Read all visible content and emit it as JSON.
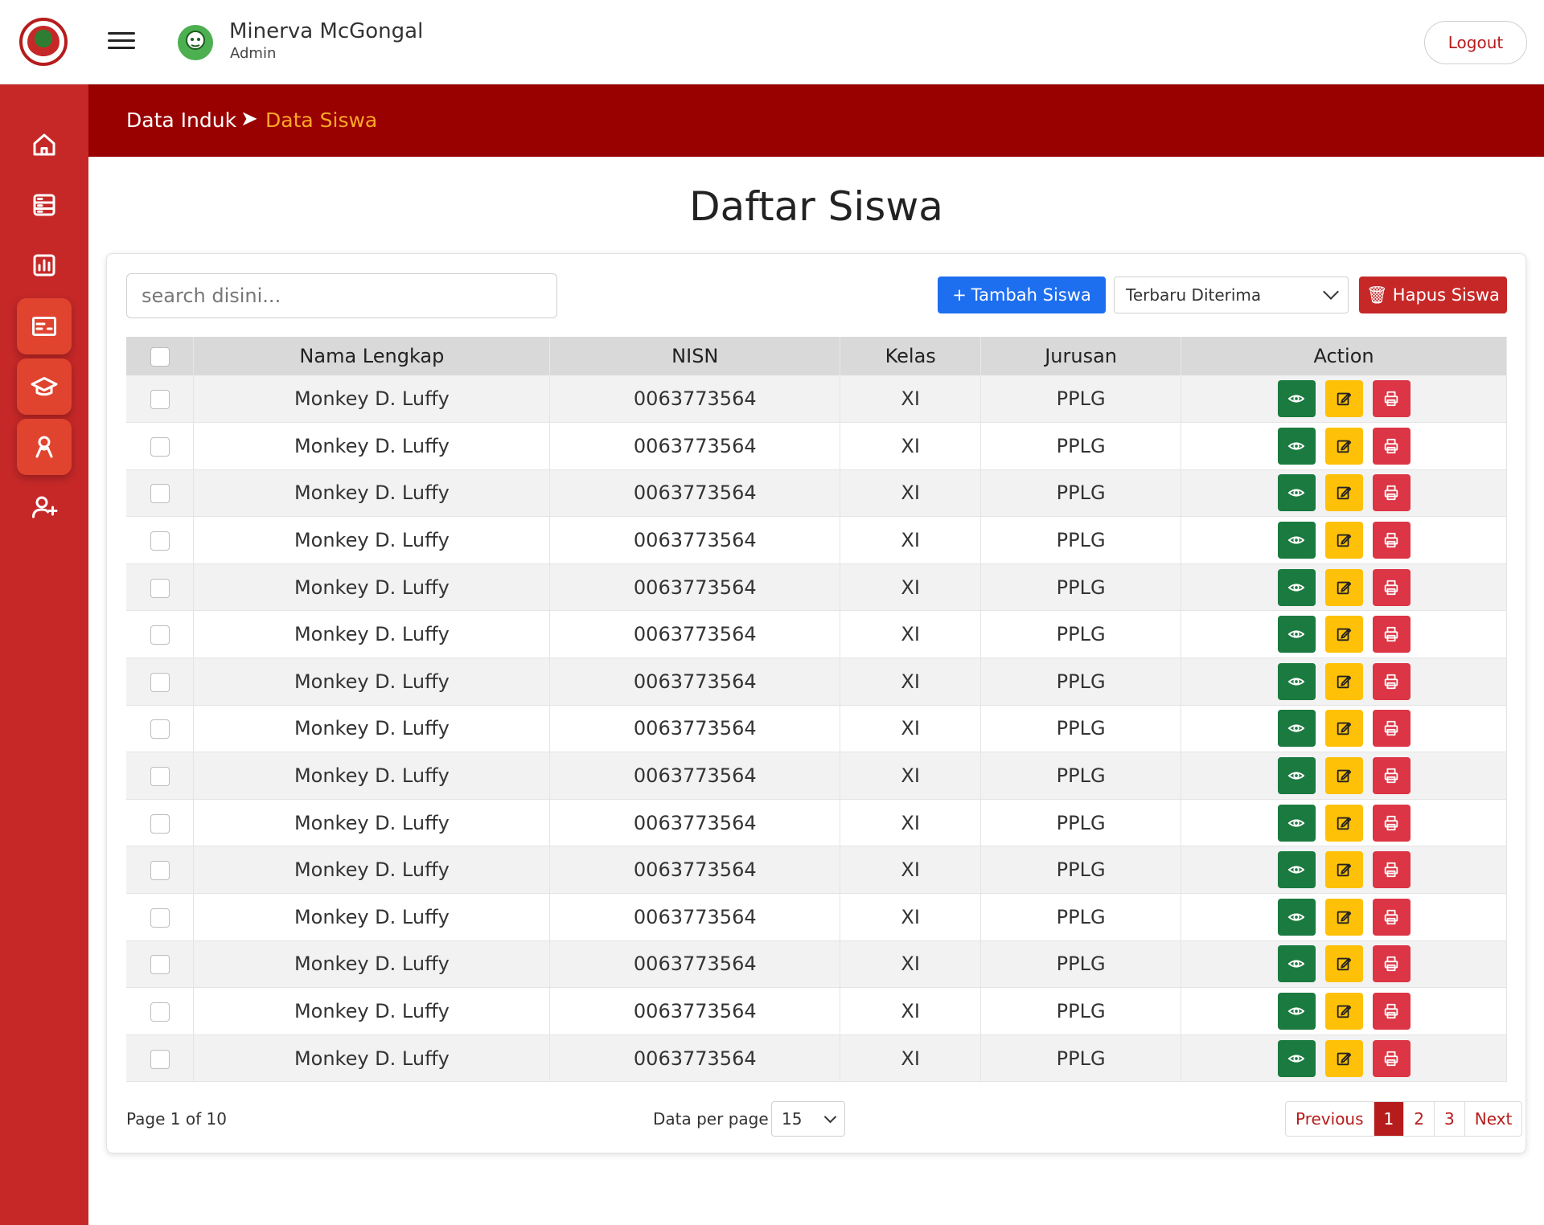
{
  "header": {
    "user_name": "Minerva McGongal",
    "user_role": "Admin",
    "logout_label": "Logout"
  },
  "sidebar": {
    "items": [
      {
        "icon": "home-icon",
        "active": false
      },
      {
        "icon": "server-icon",
        "active": false
      },
      {
        "icon": "chart-icon",
        "active": false
      },
      {
        "icon": "id-card-icon",
        "active": true
      },
      {
        "icon": "graduation-cap-icon",
        "active": true
      },
      {
        "icon": "award-person-icon",
        "active": true
      },
      {
        "icon": "user-plus-icon",
        "active": false
      }
    ]
  },
  "breadcrumb": {
    "parent": "Data Induk",
    "separator": "➤",
    "current": "Data Siswa"
  },
  "page": {
    "title": "Daftar Siswa"
  },
  "toolbar": {
    "search_placeholder": "search disini...",
    "add_label": "Tambah Siswa",
    "add_icon": "+",
    "sort_value": "Terbaru Diterima",
    "delete_label": "Hapus Siswa",
    "delete_icon": "🗑"
  },
  "table": {
    "headers": [
      "Nama Lengkap",
      "NISN",
      "Kelas",
      "Jurusan",
      "Action"
    ],
    "rows": [
      {
        "nama": "Monkey D. Luffy",
        "nisn": "0063773564",
        "kelas": "XI",
        "jurusan": "PPLG"
      },
      {
        "nama": "Monkey D. Luffy",
        "nisn": "0063773564",
        "kelas": "XI",
        "jurusan": "PPLG"
      },
      {
        "nama": "Monkey D. Luffy",
        "nisn": "0063773564",
        "kelas": "XI",
        "jurusan": "PPLG"
      },
      {
        "nama": "Monkey D. Luffy",
        "nisn": "0063773564",
        "kelas": "XI",
        "jurusan": "PPLG"
      },
      {
        "nama": "Monkey D. Luffy",
        "nisn": "0063773564",
        "kelas": "XI",
        "jurusan": "PPLG"
      },
      {
        "nama": "Monkey D. Luffy",
        "nisn": "0063773564",
        "kelas": "XI",
        "jurusan": "PPLG"
      },
      {
        "nama": "Monkey D. Luffy",
        "nisn": "0063773564",
        "kelas": "XI",
        "jurusan": "PPLG"
      },
      {
        "nama": "Monkey D. Luffy",
        "nisn": "0063773564",
        "kelas": "XI",
        "jurusan": "PPLG"
      },
      {
        "nama": "Monkey D. Luffy",
        "nisn": "0063773564",
        "kelas": "XI",
        "jurusan": "PPLG"
      },
      {
        "nama": "Monkey D. Luffy",
        "nisn": "0063773564",
        "kelas": "XI",
        "jurusan": "PPLG"
      },
      {
        "nama": "Monkey D. Luffy",
        "nisn": "0063773564",
        "kelas": "XI",
        "jurusan": "PPLG"
      },
      {
        "nama": "Monkey D. Luffy",
        "nisn": "0063773564",
        "kelas": "XI",
        "jurusan": "PPLG"
      },
      {
        "nama": "Monkey D. Luffy",
        "nisn": "0063773564",
        "kelas": "XI",
        "jurusan": "PPLG"
      },
      {
        "nama": "Monkey D. Luffy",
        "nisn": "0063773564",
        "kelas": "XI",
        "jurusan": "PPLG"
      },
      {
        "nama": "Monkey D. Luffy",
        "nisn": "0063773564",
        "kelas": "XI",
        "jurusan": "PPLG"
      }
    ]
  },
  "footer": {
    "page_info": "Page 1 of 10",
    "per_page_label": "Data per page",
    "per_page_value": "15",
    "pagination": {
      "previous": "Previous",
      "pages": [
        "1",
        "2",
        "3"
      ],
      "current": "1",
      "next": "Next"
    }
  },
  "colors": {
    "primary_red": "#c62828",
    "dark_red": "#990000",
    "accent_orange": "#ffa726",
    "blue": "#1e6ef0",
    "green": "#1b7a3f",
    "yellow": "#ffc107",
    "danger": "#dc3545"
  }
}
